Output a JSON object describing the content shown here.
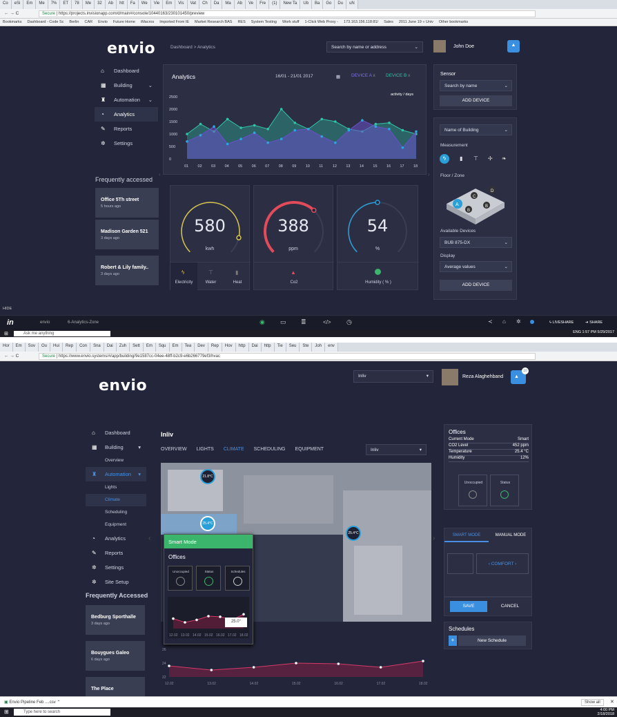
{
  "shot1": {
    "browser": {
      "tabs": [
        "Co",
        "eSi",
        "Em",
        "Me",
        "7%",
        "ET",
        "78",
        "Me",
        "32",
        "Ab",
        "htt",
        "Fa",
        "We",
        "Vie",
        "Em",
        "Vis",
        "Vat",
        "Ch",
        "Da",
        "Ma",
        "Ab",
        "Ve",
        "Fre",
        "(1)",
        "New Ta",
        "Ub",
        "Ba",
        "Go",
        "Du",
        "uN"
      ],
      "secure": "Secure",
      "url": "https://projects.invisionapp.com/d/main#/console/10440163/230101450/preview",
      "bookmarks": [
        "Bookmarks",
        "Dashboard - Code Sc",
        "Berlin",
        "CAR",
        "Envio",
        "Future Home",
        "iMacros",
        "Imported From IE",
        "Market Research BAS",
        "RES",
        "System Testing",
        "Work stuff",
        "1-Click Web Proxy -",
        "173.163.156.118:81/",
        "Sales",
        "2011 June 19 « Univ",
        "Other bookmarks"
      ]
    },
    "logo": "envio",
    "breadcrumb": "Dashboard > Analytics",
    "search": "Search by name or address",
    "user": "John Doe",
    "nav": [
      "Dashboard",
      "Building",
      "Automation",
      "Analytics",
      "Reports",
      "Settings"
    ],
    "frequently_accessed": "Frequently accessed",
    "places": [
      {
        "name": "Office 5Th street",
        "time": "5 hours ago"
      },
      {
        "name": "Madison Garden 521",
        "time": "3 days ago"
      },
      {
        "name": "Robert & Lily family..",
        "time": "3 days ago"
      }
    ],
    "analytics": {
      "title": "Analytics",
      "date_range": "16/01 - 21/01 2017",
      "device_a": "DEVICE A",
      "device_b": "DEVICE B",
      "remove": "x",
      "unit": "activity / days"
    },
    "chart_data": {
      "type": "area",
      "x": [
        "01",
        "02",
        "03",
        "04",
        "05",
        "06",
        "07",
        "08",
        "09",
        "10",
        "11",
        "12",
        "13",
        "14",
        "15",
        "16",
        "17",
        "18"
      ],
      "yticks": [
        "0",
        "500",
        "1000",
        "1500",
        "2000",
        "2500"
      ],
      "ylim": [
        0,
        2500
      ],
      "series": [
        {
          "values": [
            1000,
            1400,
            1100,
            1600,
            1250,
            1350,
            1200,
            2000,
            1450,
            1200,
            1600,
            1500,
            1200,
            1100,
            1400,
            1450,
            1150,
            1000
          ],
          "color": "#2fc6a7"
        },
        {
          "values": [
            700,
            950,
            1300,
            600,
            800,
            1050,
            650,
            800,
            1150,
            1200,
            900,
            650,
            1150,
            1550,
            1300,
            1200,
            450,
            1100
          ],
          "color": "#6a4fc9"
        }
      ]
    },
    "gauges": [
      {
        "value": "580",
        "unit": "kwh",
        "fraction": 0.88,
        "color": "#d8c44a"
      },
      {
        "value": "388",
        "unit": "ppm",
        "fraction": 0.66,
        "color": "#e24b5a"
      },
      {
        "value": "54",
        "unit": "%",
        "fraction": 0.5,
        "color": "#2a9fd8"
      }
    ],
    "gauge_tabs": [
      "Electricity",
      "Water",
      "Heat"
    ],
    "co2_label": "Co2",
    "humidity_label": "Humidity ( % )",
    "right": {
      "sensor": "Sensor",
      "search_name": "Search by name",
      "add_device": "ADD DEVICE",
      "building_name": "Name of Building",
      "measurement": "Measurement",
      "floor_zone": "Floor / Zone",
      "zones": [
        "A",
        "B",
        "C",
        "D",
        "B"
      ],
      "available_devices": "Available Devices",
      "device": "BUB 875-DX",
      "display": "Display",
      "average": "Average values",
      "add_device2": "ADD DEVICE"
    },
    "footer": {
      "hide": "HIDE",
      "envio": "envio",
      "page": "6-Analytics-Zone",
      "liveshare": "LIVESHARE",
      "share": "SHARE"
    },
    "taskbar": {
      "search": "Ask me anything",
      "time": "1:57 PM",
      "date": "5/29/2017",
      "lang": "ENG"
    }
  },
  "shot2": {
    "browser": {
      "secure": "Secure",
      "url": "https://www.envio.systems/#/app/building/9e1587cc-04ee-48ff-b2c9-e6b266779ef3/hvac",
      "tabs": [
        "Hor",
        "Em",
        "Sov",
        "Ou",
        "Hui",
        "Rep",
        "Con",
        "Sna",
        "Dai",
        "Zuh",
        "Sett",
        "Em",
        "Squ",
        "Em",
        "Tea",
        "Dev",
        "Rep",
        "Hov",
        "http",
        "Dai",
        "http",
        "Tie",
        "Seu",
        "Ste",
        "Joh",
        "env"
      ]
    },
    "logo": "envio",
    "building_select": "Inliv",
    "user": "Reza Alaghehband",
    "notif": "10",
    "nav": [
      "Dashboard",
      "Building",
      "Overview",
      "Automation",
      "Lights",
      "Climate",
      "Scheduling",
      "Equipment",
      "Analytics",
      "Reports",
      "Settings",
      "Site Setup"
    ],
    "frequently_accessed": "Frequently Accessed",
    "places": [
      {
        "name": "Bedburg Sporthalle",
        "time": "3 days ago"
      },
      {
        "name": "Bouygues Galeo",
        "time": "6 days ago"
      },
      {
        "name": "The Place",
        "time": ""
      }
    ],
    "main": {
      "title": "Inliv",
      "tabs": [
        "OVERVIEW",
        "LIGHTS",
        "CLIMATE",
        "SCHEDULING",
        "EQUIPMENT"
      ],
      "select": "Inliv",
      "temps": [
        "21.8°C",
        "25.4°C",
        "25.4°C"
      ]
    },
    "popup": {
      "mode": "Smart Mode",
      "title": "Offices",
      "cols": [
        "Unoccupied",
        "Status",
        "Schedules"
      ],
      "tooltip": "25.0°",
      "x": [
        "12.02",
        "13.02",
        "14.02",
        "15.02",
        "16.02",
        "17.02",
        "18.02"
      ]
    },
    "bottom_chart": {
      "yticks": [
        "26",
        "24",
        "22"
      ],
      "x": [
        "12.02",
        "13.02",
        "14.02",
        "15.02",
        "16.02",
        "17.02",
        "18.02"
      ]
    },
    "chart_data": {
      "type": "line",
      "x": [
        "12.02",
        "13.02",
        "14.02",
        "15.02",
        "16.02",
        "17.02",
        "18.02"
      ],
      "ylim": [
        22,
        26
      ],
      "series": [
        {
          "values": [
            23.6,
            23.0,
            23.4,
            24.0,
            23.9,
            23.4,
            24.3
          ]
        }
      ]
    },
    "offices": {
      "title": "Offices",
      "rows": [
        {
          "k": "Current Mode",
          "v": "Smart"
        },
        {
          "k": "CO2 Level",
          "v": "452 ppm"
        },
        {
          "k": "Temperature",
          "v": "25.4 °C"
        },
        {
          "k": "Humidity",
          "v": "12%"
        }
      ],
      "unoccupied": "Unoccupied",
      "status": "Status"
    },
    "modes": {
      "smart": "SMART MODE",
      "manual": "MANUAL MODE",
      "comfort": "COMFORT",
      "save": "SAVE",
      "cancel": "CANCEL"
    },
    "schedules": {
      "title": "Schedules",
      "new": "New Schedule",
      "plus": "+"
    },
    "download": {
      "file": "Envio Pipeline Feb ....csv",
      "show_all": "Show all",
      "close": "✕"
    },
    "taskbar": {
      "search": "Type here to search",
      "time": "4:00 PM",
      "date": "2/18/2018"
    }
  }
}
